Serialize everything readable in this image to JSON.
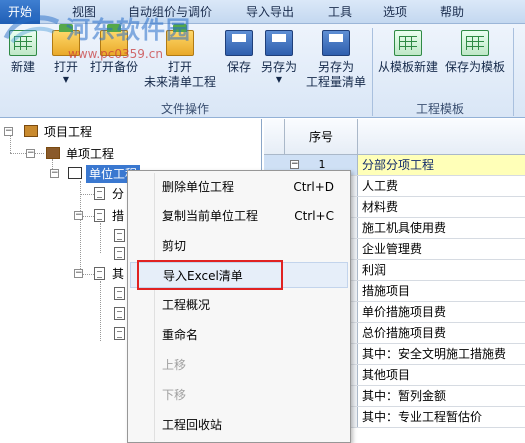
{
  "menubar": {
    "items": [
      "开始",
      "视图",
      "自动组价与调价",
      "导入导出",
      "工具",
      "选项",
      "帮助"
    ]
  },
  "watermark": {
    "main": "河东软件园",
    "url": "www.pc0359.cn"
  },
  "ribbon": {
    "buttons": {
      "new": "新建",
      "open": "打开",
      "open_backup": "打开备份",
      "open_future_l1": "打开",
      "open_future_l2": "未来清单工程",
      "save": "保存",
      "save_as": "另存为",
      "save_as_list_l1": "另存为",
      "save_as_list_l2": "工程量清单",
      "new_from_template": "从模板新建",
      "save_as_template": "保存为模板"
    },
    "groups": {
      "file_ops": "文件操作",
      "project_template": "工程模板"
    }
  },
  "tree": {
    "root": "项目工程",
    "single_project": "单项工程",
    "unit_project": "单位工程",
    "child1": "分",
    "child2": "措",
    "child3": "其"
  },
  "grid": {
    "header_seq": "序号",
    "rows": [
      {
        "seq": "1",
        "text": "分部分项工程"
      },
      {
        "seq": "",
        "text": "人工费"
      },
      {
        "seq": "",
        "text": "材料费"
      },
      {
        "seq": "",
        "text": "施工机具使用费"
      },
      {
        "seq": "",
        "text": "企业管理费"
      },
      {
        "seq": "",
        "text": "利润"
      },
      {
        "seq": "",
        "text": "措施项目"
      },
      {
        "seq": "",
        "text": "单价措施项目费"
      },
      {
        "seq": "",
        "text": "总价措施项目费"
      },
      {
        "seq": "",
        "text": "其中：安全文明施工措施费"
      },
      {
        "seq": "",
        "text": "其他项目"
      },
      {
        "seq": "",
        "text": "其中：暂列金额"
      },
      {
        "seq": "",
        "text": "其中：专业工程暂估价"
      }
    ]
  },
  "context_menu": {
    "items": [
      {
        "label": "删除单位工程",
        "shortcut": "Ctrl+D"
      },
      {
        "label": "复制当前单位工程",
        "shortcut": "Ctrl+C"
      },
      {
        "label": "剪切",
        "shortcut": ""
      },
      {
        "label": "导入Excel清单",
        "shortcut": ""
      },
      {
        "label": "工程概况",
        "shortcut": ""
      },
      {
        "label": "重命名",
        "shortcut": ""
      },
      {
        "label": "上移",
        "shortcut": ""
      },
      {
        "label": "下移",
        "shortcut": ""
      },
      {
        "label": "工程回收站",
        "shortcut": ""
      }
    ]
  },
  "colors": {
    "highlight_row": "#ffffb8",
    "selected_node": "#3a78d0",
    "red_box": "#e02222"
  }
}
